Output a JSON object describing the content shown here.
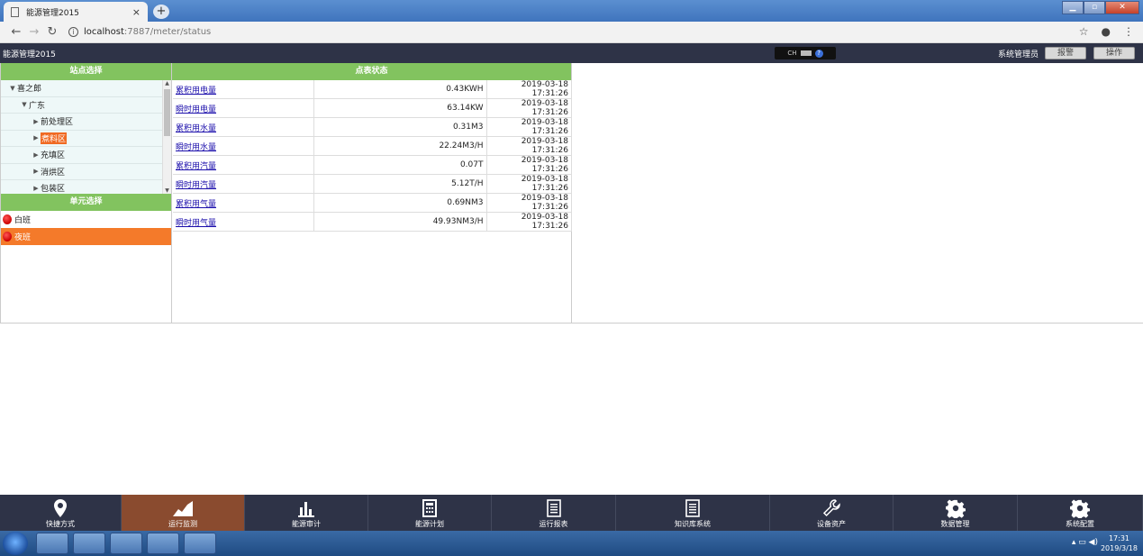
{
  "browser": {
    "tab_title": "能源管理2015",
    "close_glyph": "×",
    "newtab_glyph": "+",
    "url_host": "localhost",
    "url_path": ":7887/meter/status"
  },
  "header": {
    "app_title": "能源管理2015",
    "lang": "CH",
    "user": "系统管理员",
    "btn_alarm": "报警",
    "btn_operate": "操作"
  },
  "site_panel": {
    "title": "站点选择",
    "tree": [
      {
        "label": "喜之郎",
        "level": 0,
        "expanded": true
      },
      {
        "label": "广东",
        "level": 1,
        "expanded": true
      },
      {
        "label": "前处理区",
        "level": 2,
        "expanded": false
      },
      {
        "label": "煮料区",
        "level": 2,
        "expanded": false,
        "selected": true
      },
      {
        "label": "充填区",
        "level": 2,
        "expanded": false
      },
      {
        "label": "消烘区",
        "level": 2,
        "expanded": false
      },
      {
        "label": "包装区",
        "level": 2,
        "expanded": false
      }
    ]
  },
  "unit_panel": {
    "title": "单元选择",
    "units": [
      {
        "label": "白班",
        "active": false
      },
      {
        "label": "夜班",
        "active": true
      }
    ]
  },
  "status_panel": {
    "title": "点表状态",
    "rows": [
      {
        "name": "累积用电量",
        "value": "0.43KWH",
        "time": "2019-03-18 17:31:26"
      },
      {
        "name": "瞬时用电量",
        "value": "63.14KW",
        "time": "2019-03-18 17:31:26"
      },
      {
        "name": "累积用水量",
        "value": "0.31M3",
        "time": "2019-03-18 17:31:26"
      },
      {
        "name": "瞬时用水量",
        "value": "22.24M3/H",
        "time": "2019-03-18 17:31:26"
      },
      {
        "name": "累积用汽量",
        "value": "0.07T",
        "time": "2019-03-18 17:31:26"
      },
      {
        "name": "瞬时用汽量",
        "value": "5.12T/H",
        "time": "2019-03-18 17:31:26"
      },
      {
        "name": "累积用气量",
        "value": "0.69NM3",
        "time": "2019-03-18 17:31:26"
      },
      {
        "name": "瞬时用气量",
        "value": "49.93NM3/H",
        "time": "2019-03-18 17:31:26"
      }
    ]
  },
  "bottom_nav": [
    {
      "label": "快捷方式",
      "icon": "map-pin-icon",
      "active": false
    },
    {
      "label": "运行监测",
      "icon": "area-chart-icon",
      "active": true
    },
    {
      "label": "能源审计",
      "icon": "bar-chart-icon",
      "active": false
    },
    {
      "label": "能源计划",
      "icon": "calculator-icon",
      "active": false
    },
    {
      "label": "运行报表",
      "icon": "document-icon",
      "active": false
    },
    {
      "label": "知识库系统",
      "icon": "document-icon",
      "active": false
    },
    {
      "label": "设备资产",
      "icon": "wrench-icon",
      "active": false
    },
    {
      "label": "数据管理",
      "icon": "gear-icon",
      "active": false
    },
    {
      "label": "系统配置",
      "icon": "gear-icon",
      "active": false
    }
  ],
  "taskbar": {
    "time": "17:31",
    "date": "2019/3/18"
  },
  "colors": {
    "accent_green": "#82c35f",
    "accent_orange": "#f47a2a",
    "header_dark": "#2e3347",
    "nav_active": "#8a4b2f"
  }
}
